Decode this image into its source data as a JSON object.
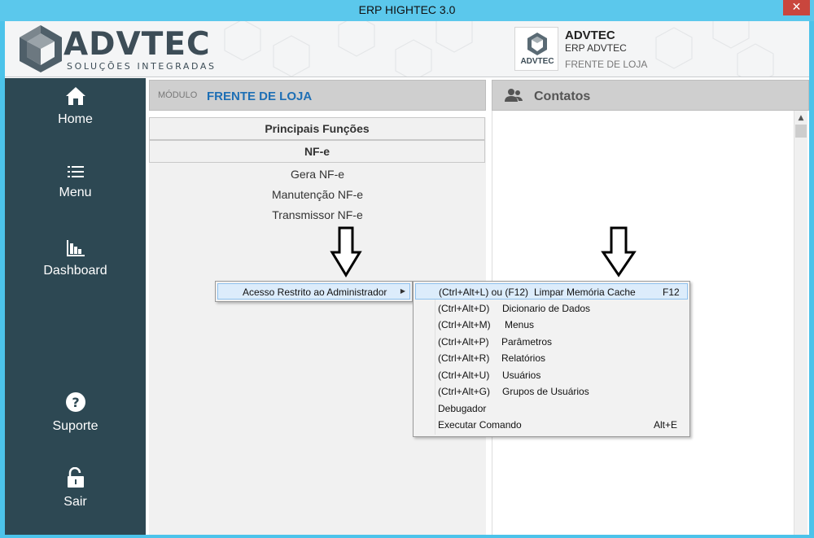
{
  "window": {
    "title": "ERP HIGHTEC 3.0",
    "close_glyph": "✕"
  },
  "logo": {
    "word": "ADVTEC",
    "subtitle": "SOLUÇÕES INTEGRADAS"
  },
  "company": {
    "logo_text": "ADVTEC",
    "name": "ADVTEC",
    "system": "ERP ADVTEC",
    "module": "FRENTE DE LOJA"
  },
  "sidebar": {
    "items": [
      {
        "label": "Home",
        "icon": "home-icon"
      },
      {
        "label": "Menu",
        "icon": "list-icon"
      },
      {
        "label": "Dashboard",
        "icon": "bar-chart-icon"
      },
      {
        "label": "Suporte",
        "icon": "question-icon"
      },
      {
        "label": "Sair",
        "icon": "unlock-icon"
      }
    ]
  },
  "module": {
    "label": "MÓDULO",
    "name": "FRENTE DE LOJA"
  },
  "functions": {
    "heading": "Principais Funções",
    "section": "NF-e",
    "items": [
      "Gera NF-e",
      "Manutenção NF-e",
      "Transmissor NF-e"
    ]
  },
  "contacts": {
    "title": "Contatos",
    "icon": "contacts-icon"
  },
  "context_menu": {
    "item": "Acesso Restrito ao Administrador",
    "submenu": [
      {
        "keys": "(Ctrl+Alt+L) ou (F12)",
        "label": "Limpar Memória Cache",
        "shortcut": "F12"
      },
      {
        "keys": "(Ctrl+Alt+D)",
        "label": "Dicionario de Dados",
        "shortcut": ""
      },
      {
        "keys": "(Ctrl+Alt+M)",
        "label": "Menus",
        "shortcut": ""
      },
      {
        "keys": "(Ctrl+Alt+P)",
        "label": "Parâmetros",
        "shortcut": ""
      },
      {
        "keys": "(Ctrl+Alt+R)",
        "label": "Relatórios",
        "shortcut": ""
      },
      {
        "keys": "(Ctrl+Alt+U)",
        "label": "Usuários",
        "shortcut": ""
      },
      {
        "keys": "(Ctrl+Alt+G)",
        "label": "Grupos de Usuários",
        "shortcut": ""
      },
      {
        "keys": "Debugador",
        "label": "",
        "shortcut": ""
      },
      {
        "keys": "Executar Comando",
        "label": "",
        "shortcut": "Alt+E"
      }
    ]
  },
  "colors": {
    "titlebar": "#5bc8ec",
    "sidebar": "#2d4853",
    "module_accent": "#1e6fb5",
    "menu_highlight": "#dcecfb"
  }
}
